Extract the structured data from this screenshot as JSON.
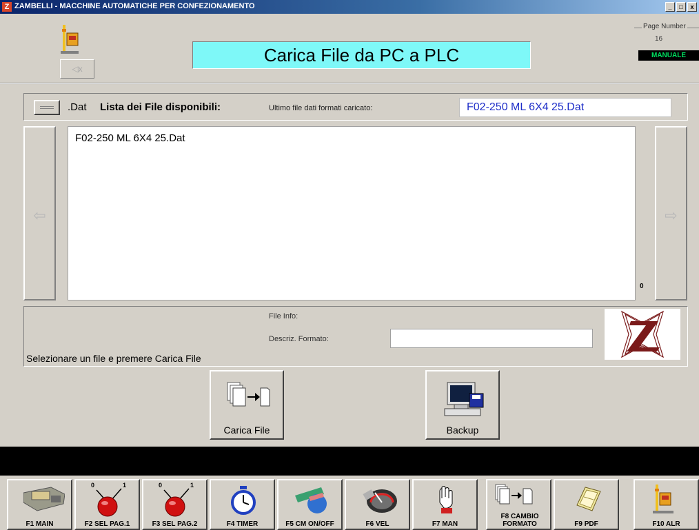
{
  "window": {
    "title": "ZAMBELLI - MACCHINE AUTOMATICHE PER CONFEZIONAMENTO",
    "app_icon_glyph": "Z",
    "controls": [
      "_",
      "□",
      "x"
    ]
  },
  "header": {
    "title": "Carica File da PC a PLC",
    "mute_label": "◁x",
    "page_number_label": "Page Number",
    "page_number": "16",
    "mode": "MANUALE"
  },
  "file_list": {
    "extension": ".Dat",
    "title": "Lista dei File disponibili:",
    "last_loaded_label": "Ultimo file dati formati caricato:",
    "last_loaded_value": "F02-250 ML 6X4 25.Dat",
    "items": [
      "F02-250 ML 6X4 25.Dat"
    ],
    "count": "0",
    "left_arrow": "⇦",
    "right_arrow": "⇨"
  },
  "file_info": {
    "info_label": "File Info:",
    "description_label": "Descriz. Formato:",
    "description_value": "",
    "hint": "Selezionare un file e premere Carica File"
  },
  "actions": {
    "load_label": "Carica File",
    "backup_label": "Backup"
  },
  "function_keys": [
    {
      "label": "F1 MAIN",
      "icon": "machine-icon"
    },
    {
      "label": "F2 SEL PAG.1",
      "icon": "selector-switch-icon",
      "marks": [
        "0",
        "1"
      ]
    },
    {
      "label": "F3 SEL PAG.2",
      "icon": "selector-switch-icon",
      "marks": [
        "0",
        "1"
      ]
    },
    {
      "label": "F4 TIMER",
      "icon": "stopwatch-icon"
    },
    {
      "label": "F5 CM ON/OFF",
      "icon": "cm-toggle-icon"
    },
    {
      "label": "F6 VEL",
      "icon": "speedometer-icon"
    },
    {
      "label": "F7 MAN",
      "icon": "hand-icon"
    },
    {
      "label": "F8 CAMBIO FORMATO",
      "icon": "format-change-icon"
    },
    {
      "label": "F9 PDF",
      "icon": "pdf-document-icon"
    },
    {
      "label": "F10 ALR",
      "icon": "alarm-icon"
    }
  ],
  "colors": {
    "title_bg": "#7ef8f8",
    "mode_text": "#00e060",
    "last_file_text": "#1e2ec8",
    "logo_red": "#7a1a1a"
  }
}
